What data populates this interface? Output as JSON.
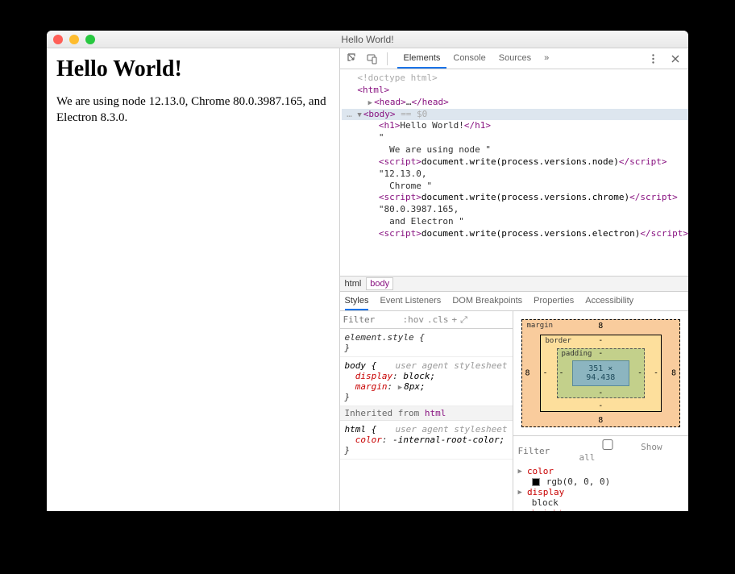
{
  "window": {
    "title": "Hello World!"
  },
  "page": {
    "heading": "Hello World!",
    "body": "We are using node 12.13.0, Chrome 80.0.3987.165, and Electron 8.3.0."
  },
  "devtools": {
    "tabs": [
      "Elements",
      "Console",
      "Sources"
    ],
    "activeTab": "Elements",
    "more": "»",
    "dom": {
      "lines": [
        {
          "indent": 1,
          "html": "<span class='gray'>&lt;!doctype html&gt;</span>"
        },
        {
          "indent": 1,
          "html": "<span class='tag'>&lt;html&gt;</span>"
        },
        {
          "indent": 2,
          "html": "<span class='tri'>▶</span><span class='tag'>&lt;head&gt;</span>…<span class='tag'>&lt;/head&gt;</span>"
        },
        {
          "indent": 0,
          "sel": true,
          "html": "<span class='gray'>…</span> <span class='tri'>▼</span><span class='tag'>&lt;body&gt;</span> <span class='gray'>== $0</span>"
        },
        {
          "indent": 3,
          "html": "<span class='tag'>&lt;h1&gt;</span>Hello World!<span class='tag'>&lt;/h1&gt;</span>"
        },
        {
          "indent": 3,
          "html": "\""
        },
        {
          "indent": 4,
          "html": "We are using node \""
        },
        {
          "indent": 3,
          "html": "<span class='tag'>&lt;script&gt;</span><span class='text'>document.write(process.versions.node)</span><span class='tag'>&lt;/script&gt;</span>"
        },
        {
          "indent": 3,
          "html": "\"12.13.0,"
        },
        {
          "indent": 4,
          "html": "Chrome \""
        },
        {
          "indent": 3,
          "html": "<span class='tag'>&lt;script&gt;</span><span class='text'>document.write(process.versions.chrome)</span><span class='tag'>&lt;/script&gt;</span>"
        },
        {
          "indent": 3,
          "html": "\"80.0.3987.165,"
        },
        {
          "indent": 4,
          "html": "and Electron \""
        },
        {
          "indent": 3,
          "html": "<span class='tag'>&lt;script&gt;</span><span class='text'>document.write(process.versions.electron)</span><span class='tag'>&lt;/script&gt;</span>"
        }
      ]
    },
    "breadcrumbs": [
      "html",
      "body"
    ],
    "subtabs": [
      "Styles",
      "Event Listeners",
      "DOM Breakpoints",
      "Properties",
      "Accessibility"
    ],
    "activeSubtab": "Styles",
    "stylesFilter": {
      "placeholder": "Filter",
      "hov": ":hov",
      "cls": ".cls",
      "plus": "+"
    },
    "rules": {
      "elementStyle": "element.style {",
      "close": "}",
      "body": {
        "sel": "body {",
        "origin": "user agent stylesheet",
        "props": [
          {
            "name": "display",
            "val": "block;"
          },
          {
            "name": "margin",
            "val": "8px;",
            "tri": true
          }
        ]
      },
      "inheritedHdr": "Inherited from ",
      "inheritedTag": "html",
      "html": {
        "sel": "html {",
        "origin": "user agent stylesheet",
        "props": [
          {
            "name": "color",
            "val": "-internal-root-color;"
          }
        ]
      }
    },
    "boxmodel": {
      "marginLabel": "margin",
      "borderLabel": "border",
      "paddingLabel": "padding",
      "marginVals": {
        "t": "8",
        "r": "8",
        "b": "8",
        "l": "8"
      },
      "borderVals": {
        "t": "-",
        "r": "-",
        "b": "-",
        "l": "-"
      },
      "paddingVals": {
        "t": "-",
        "r": "-",
        "b": "-",
        "l": "-"
      },
      "content": "351 × 94.438"
    },
    "computed": {
      "filterPlaceholder": "Filter",
      "showAll": "Show all",
      "props": [
        {
          "name": "color",
          "val": "rgb(0, 0, 0)",
          "swatch": true
        },
        {
          "name": "display",
          "val": "block"
        },
        {
          "name": "height",
          "val": "",
          "faded": true
        }
      ]
    }
  }
}
